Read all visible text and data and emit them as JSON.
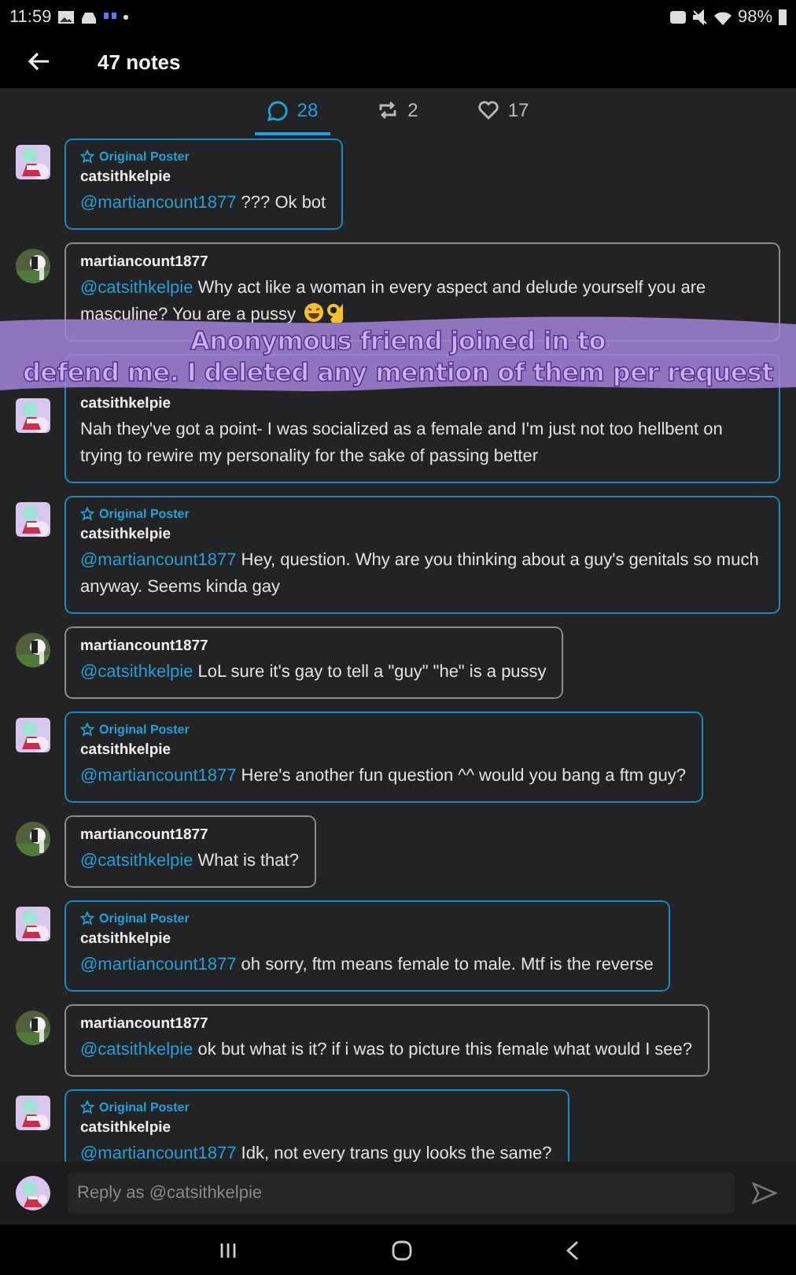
{
  "status_bar": {
    "time": "11:59",
    "battery": "98%"
  },
  "header": {
    "title": "47 notes"
  },
  "tabs": [
    {
      "kind": "replies",
      "count": "28",
      "selected": true
    },
    {
      "kind": "reblogs",
      "count": "2",
      "selected": false
    },
    {
      "kind": "likes",
      "count": "17",
      "selected": false
    }
  ],
  "notes": [
    {
      "author": "catsithkelpie",
      "op": true,
      "op_label": "Original Poster",
      "mention": "@martiancount1877",
      "text": "??? Ok bot"
    },
    {
      "author": "martiancount1877",
      "op": false,
      "mention": "@catsithkelpie",
      "text": "Why act like a woman in every aspect and delude yourself you are masculine? You are a pussy",
      "trailing_emoji": true
    },
    {
      "author": "catsithkelpie",
      "op": true,
      "text": "Nah they've got a point- I was socialized as a female and I'm just not too hellbent on trying to rewire my personality for the sake of passing better"
    },
    {
      "author": "catsithkelpie",
      "op": true,
      "op_label": "Original Poster",
      "mention": "@martiancount1877",
      "text": "Hey, question. Why are you thinking about a guy's genitals so much anyway. Seems kinda gay"
    },
    {
      "author": "martiancount1877",
      "op": false,
      "mention": "@catsithkelpie",
      "text": "LoL sure it's gay to tell a \"guy\" \"he\" is a pussy"
    },
    {
      "author": "catsithkelpie",
      "op": true,
      "op_label": "Original Poster",
      "mention": "@martiancount1877",
      "text": "Here's another fun question ^^ would you bang a ftm guy?"
    },
    {
      "author": "martiancount1877",
      "op": false,
      "mention": "@catsithkelpie",
      "text": "What is that?"
    },
    {
      "author": "catsithkelpie",
      "op": true,
      "op_label": "Original Poster",
      "mention": "@martiancount1877",
      "text": " oh sorry, ftm means female to male. Mtf is the reverse"
    },
    {
      "author": "martiancount1877",
      "op": false,
      "mention": "@catsithkelpie",
      "text": "ok but what is it? if i was to picture this female what would I see?"
    },
    {
      "author": "catsithkelpie",
      "op": true,
      "op_label": "Original Poster",
      "mention": "@martiancount1877",
      "text": "Idk, not every trans guy looks the same?"
    }
  ],
  "overlay": {
    "lines": [
      "Anonymous friend joined in to",
      "defend me. I deleted any mention of them per request"
    ]
  },
  "reply": {
    "placeholder": "Reply as @catsithkelpie"
  }
}
